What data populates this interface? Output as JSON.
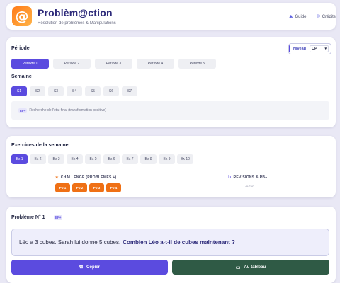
{
  "header": {
    "logo_glyph": "@",
    "title": "Problèm@ction",
    "subtitle": "Résolution de problèmes & Manipulations",
    "links": [
      {
        "label": "Guide",
        "icon": "sparkle-icon"
      },
      {
        "label": "Crédits",
        "icon": "copyright-icon"
      }
    ]
  },
  "period_card": {
    "title": "Période",
    "periods": [
      "Période 1",
      "Période 2",
      "Période 3",
      "Période 4",
      "Période 5"
    ],
    "active_period": 0,
    "niveau_label": "Niveau",
    "niveau_value": "CP",
    "week_title": "Semaine",
    "weeks": [
      "S1",
      "S2",
      "S3",
      "S4",
      "S5",
      "S6",
      "S7"
    ],
    "active_week": 0,
    "info_badge": "EF+",
    "info_text": "Recherche de l'état final (transformation positive)"
  },
  "exercises_card": {
    "title": "Exercices de la semaine",
    "exercises": [
      "Ex 1",
      "Ex 2",
      "Ex 3",
      "Ex 4",
      "Ex 5",
      "Ex 6",
      "Ex 7",
      "Ex 8",
      "Ex 9",
      "Ex 10"
    ],
    "active_exercise": 0,
    "challenge_label": "CHALLENGE (PROBLÈMES +)",
    "problems": [
      "Pb 1",
      "Pb 2",
      "Pb 3",
      "Pb 4"
    ],
    "revisions_label": "RÉVISIONS & PB+",
    "revisions_empty": "Aucun"
  },
  "problem_card": {
    "title": "Problème N° 1",
    "badge": "EF+",
    "statement": "Léo a 3 cubes. Sarah lui donne 5 cubes.",
    "question": "Combien Léo a-t-il de cubes maintenant ?",
    "copy_label": "Copier",
    "board_label": "Au tableau"
  },
  "colors": {
    "accent": "#5b4bdf",
    "problem_orange": "#ef7015",
    "board_green": "#2f5a45",
    "background": "#e9e8f5"
  }
}
